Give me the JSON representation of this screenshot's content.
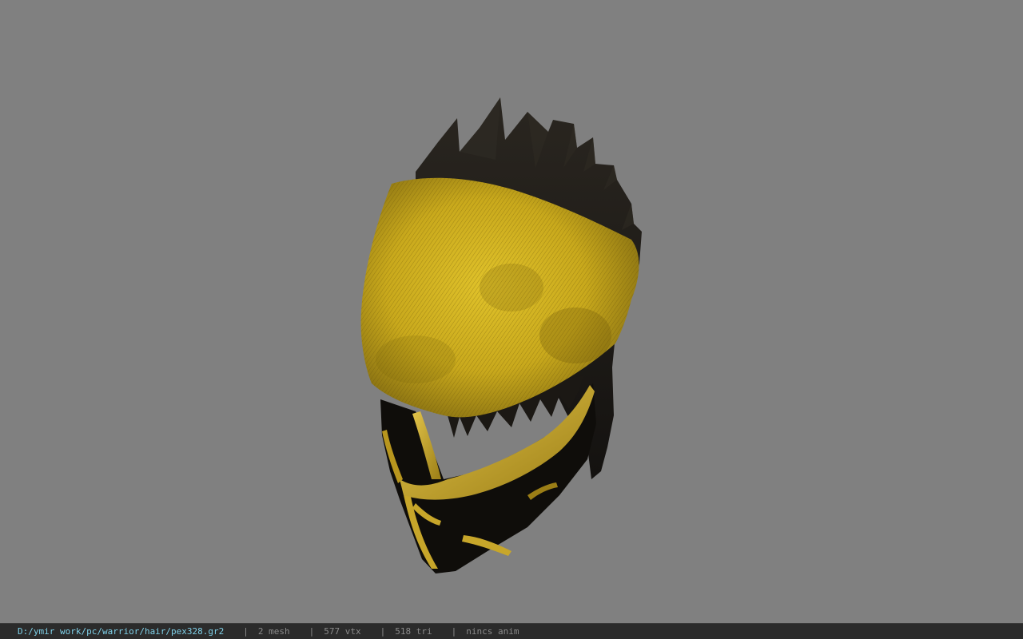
{
  "viewer": {
    "background_color": "#808080",
    "model": {
      "description_icon": "helmet-model",
      "colors": {
        "cloth_yellow": "#c9a91c",
        "cloth_shadow": "#8d7410",
        "hair_dark": "#1e1b16",
        "mask_black": "#0f0d0a",
        "trim_gold": "#c7a62a"
      }
    }
  },
  "status": {
    "path": "D:/ymir work/pc/warrior/hair/pex328.gr2",
    "separator": "|",
    "mesh": "2 mesh",
    "vertices": "577 vtx",
    "triangles": "518 tri",
    "animation": "nincs anim"
  }
}
